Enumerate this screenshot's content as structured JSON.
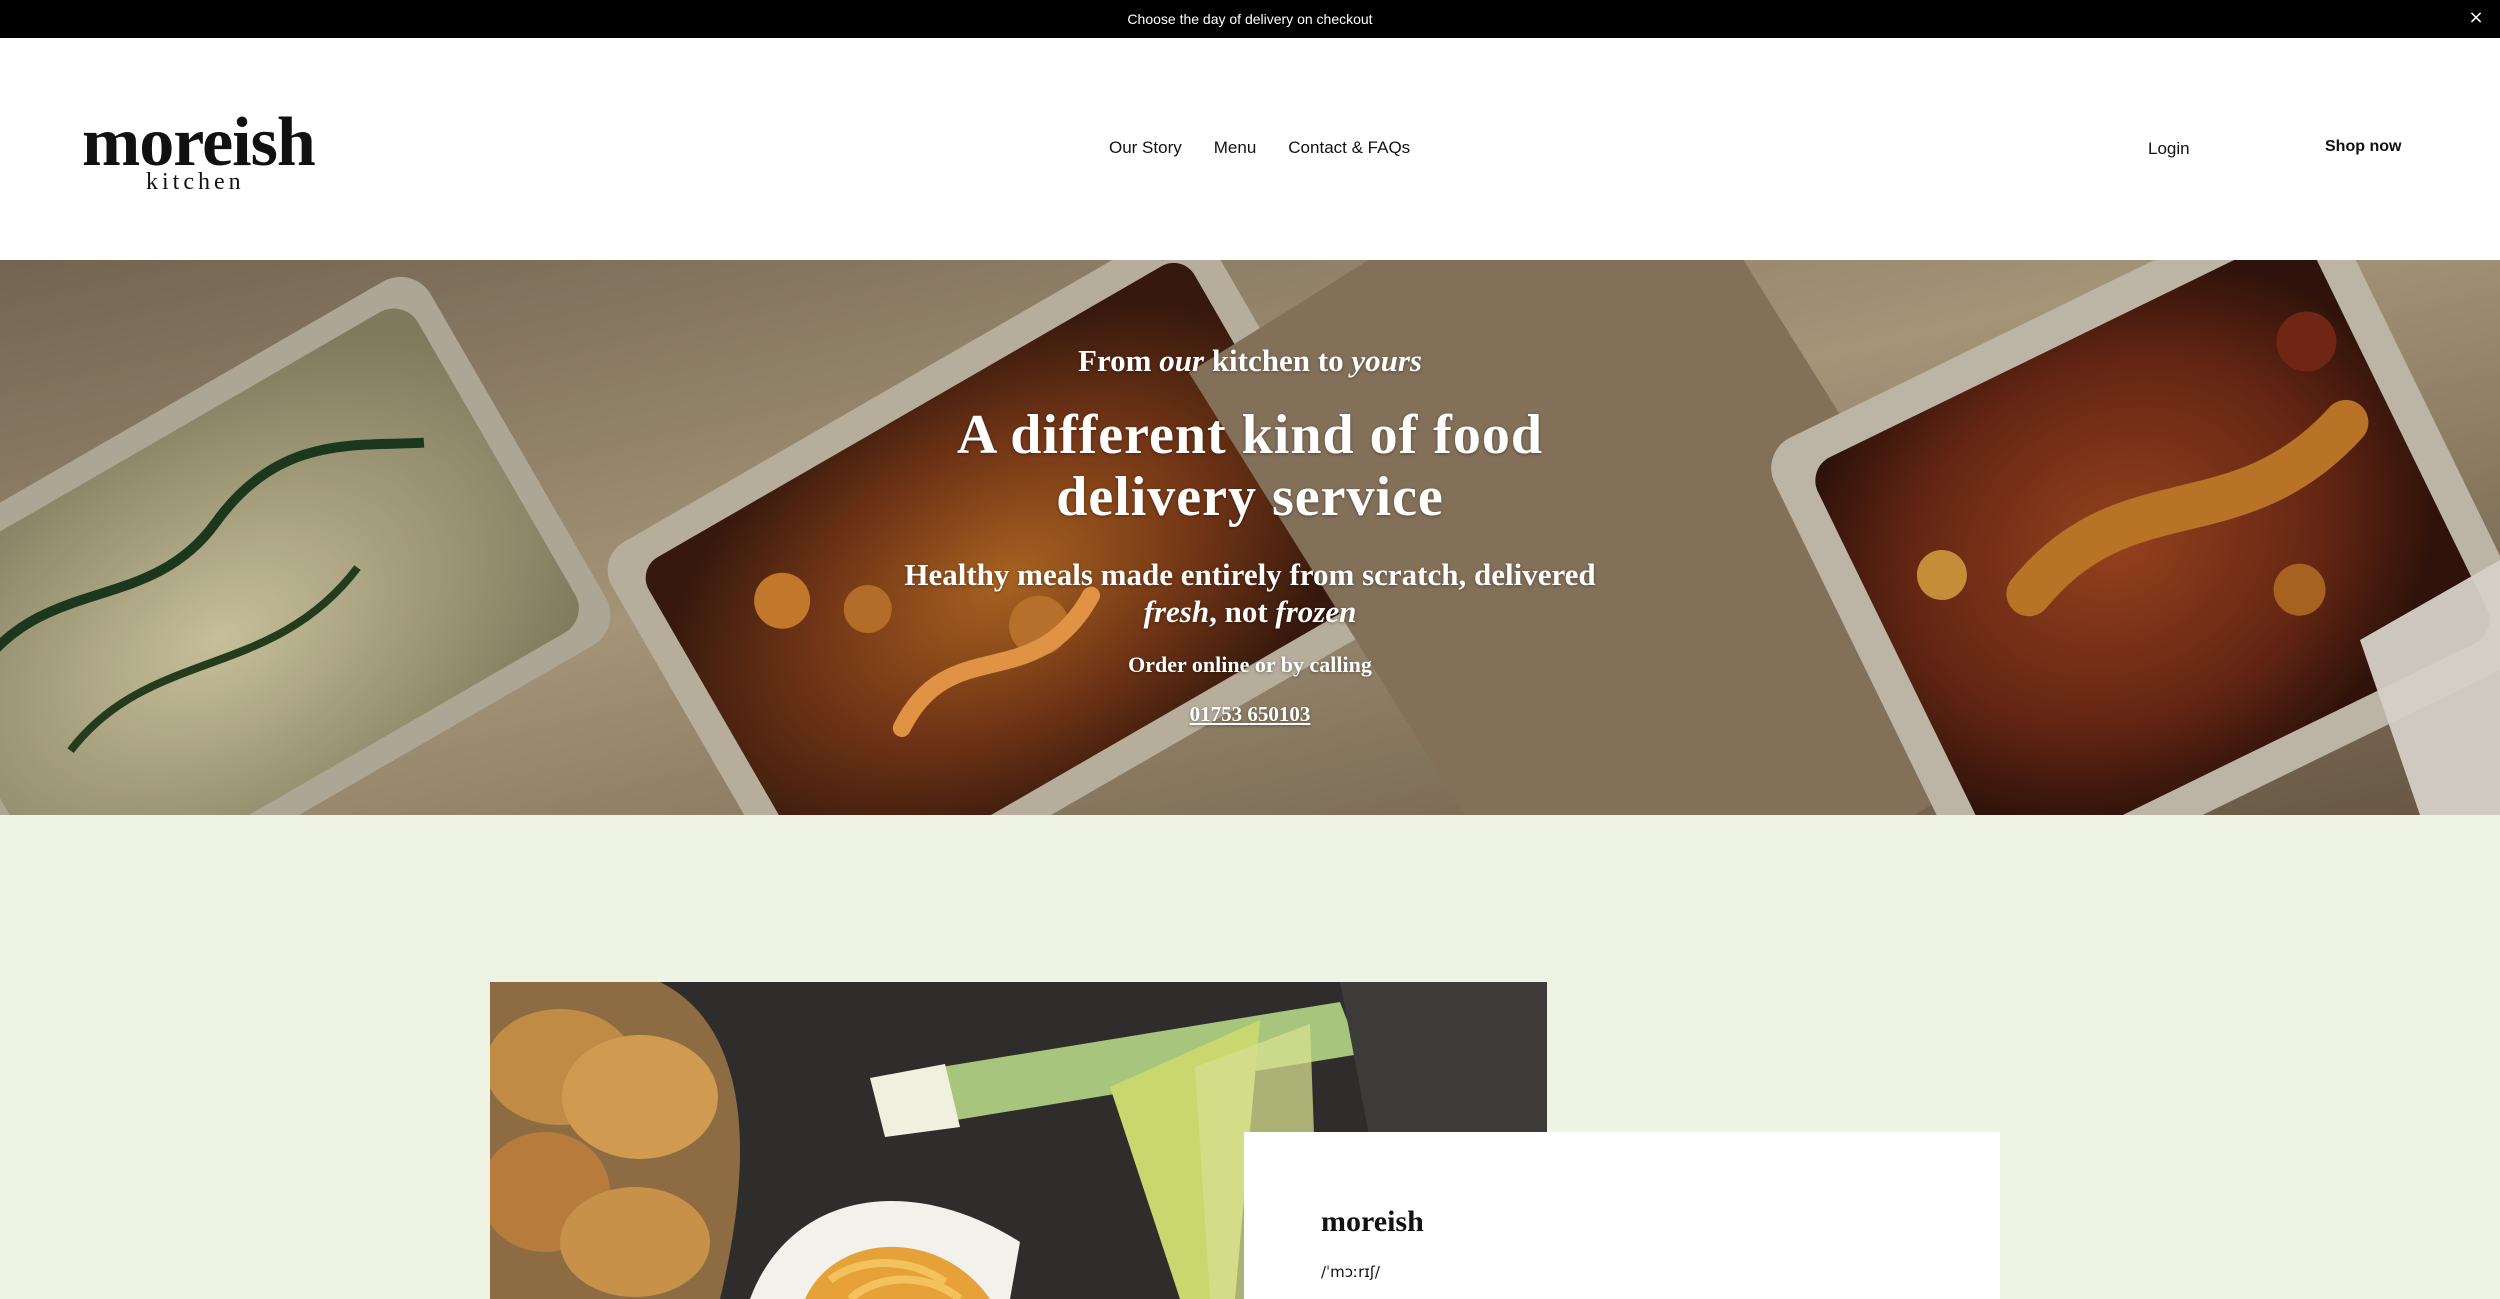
{
  "announcement": {
    "text": "Choose the day of delivery on checkout",
    "close_label": "×"
  },
  "brand": {
    "name": "moreish",
    "sub": "kitchen"
  },
  "nav": [
    "Our Story",
    "Menu",
    "Contact & FAQs"
  ],
  "header_actions": {
    "login": "Login",
    "shop": "Shop now"
  },
  "hero": {
    "eyebrow_start": "From ",
    "eyebrow_em_1": "our",
    "eyebrow_middle": " kitchen to ",
    "eyebrow_em_2": "yours",
    "headline_line_1": "A different kind of food",
    "headline_line_2": "delivery service",
    "subhead_line_1": "Healthy meals made entirely from scratch, delivered",
    "subhead_em_1": "fresh",
    "subhead_middle": ", not ",
    "subhead_em_2": "frozen",
    "order_text": "Order online or by calling",
    "phone": "01753 650103"
  },
  "definition": {
    "word": "moreish",
    "pronunciation": "/ˈmɔːrɪʃ/"
  },
  "colors": {
    "announcement": "#000000",
    "header": "#ffffff",
    "page": "#eff3e4",
    "hero_text": "#ffffff"
  }
}
